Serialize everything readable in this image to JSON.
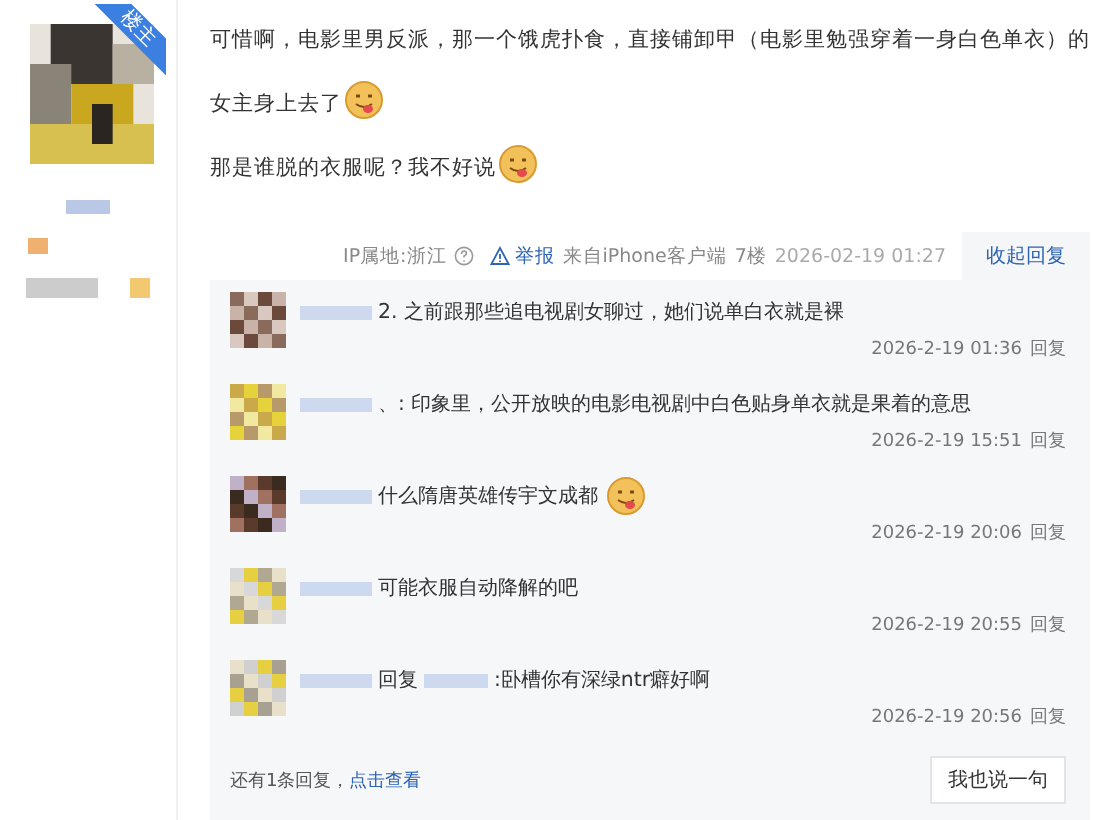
{
  "post": {
    "badge": "楼主",
    "lines": [
      {
        "text": "可惜啊，电影里男反派，那一个饿虎扑食，直接铺卸甲（电影里勉强穿着一身白色单衣）的",
        "emoji": false
      },
      {
        "text": "女主身上去了",
        "emoji": true
      },
      {
        "text": "那是谁脱的衣服呢？我不好说",
        "emoji": true
      }
    ],
    "footer": {
      "ip": "IP属地:浙江",
      "report": "举报",
      "source": "来自iPhone客户端",
      "floor": "7楼",
      "time": "2026-02-19 01:27",
      "collapse": "收起回复"
    }
  },
  "replies": [
    {
      "text": "2. 之前跟那些追电视剧女聊过，她们说单白衣就是裸",
      "emoji": false,
      "time": "2026-2-19 01:36",
      "action": "回复"
    },
    {
      "text": "、: 印象里，公开放映的电影电视剧中白色贴身单衣就是果着的意思",
      "emoji": false,
      "time": "2026-2-19 15:51",
      "action": "回复"
    },
    {
      "text": "什么隋唐英雄传宇文成都",
      "emoji": true,
      "time": "2026-2-19 20:06",
      "action": "回复"
    },
    {
      "text": "可能衣服自动降解的吧",
      "emoji": false,
      "time": "2026-2-19 20:55",
      "action": "回复"
    },
    {
      "prefix": "回复",
      "text": ":卧槽你有深绿ntr癖好啊",
      "emoji": false,
      "time": "2026-2-19 20:56",
      "action": "回复"
    }
  ],
  "more": {
    "text": "还有1条回复，",
    "link": "点击查看"
  },
  "say_button": "我也说一句"
}
